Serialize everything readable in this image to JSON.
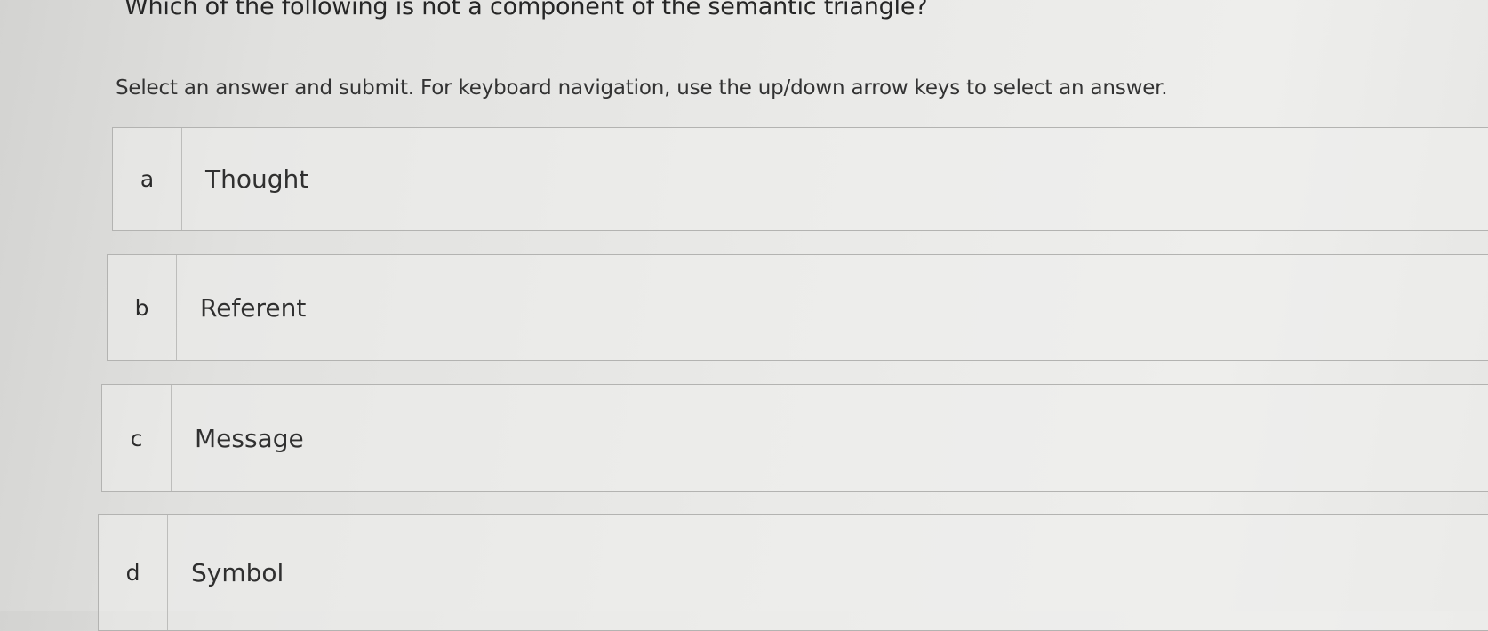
{
  "question": "Which of the following is not a component of the semantic triangle?",
  "instructions": "Select an answer and submit. For keyboard navigation, use the up/down arrow keys to select an answer.",
  "options": [
    {
      "letter": "a",
      "text": "Thought"
    },
    {
      "letter": "b",
      "text": "Referent"
    },
    {
      "letter": "c",
      "text": "Message"
    },
    {
      "letter": "d",
      "text": "Symbol"
    }
  ]
}
